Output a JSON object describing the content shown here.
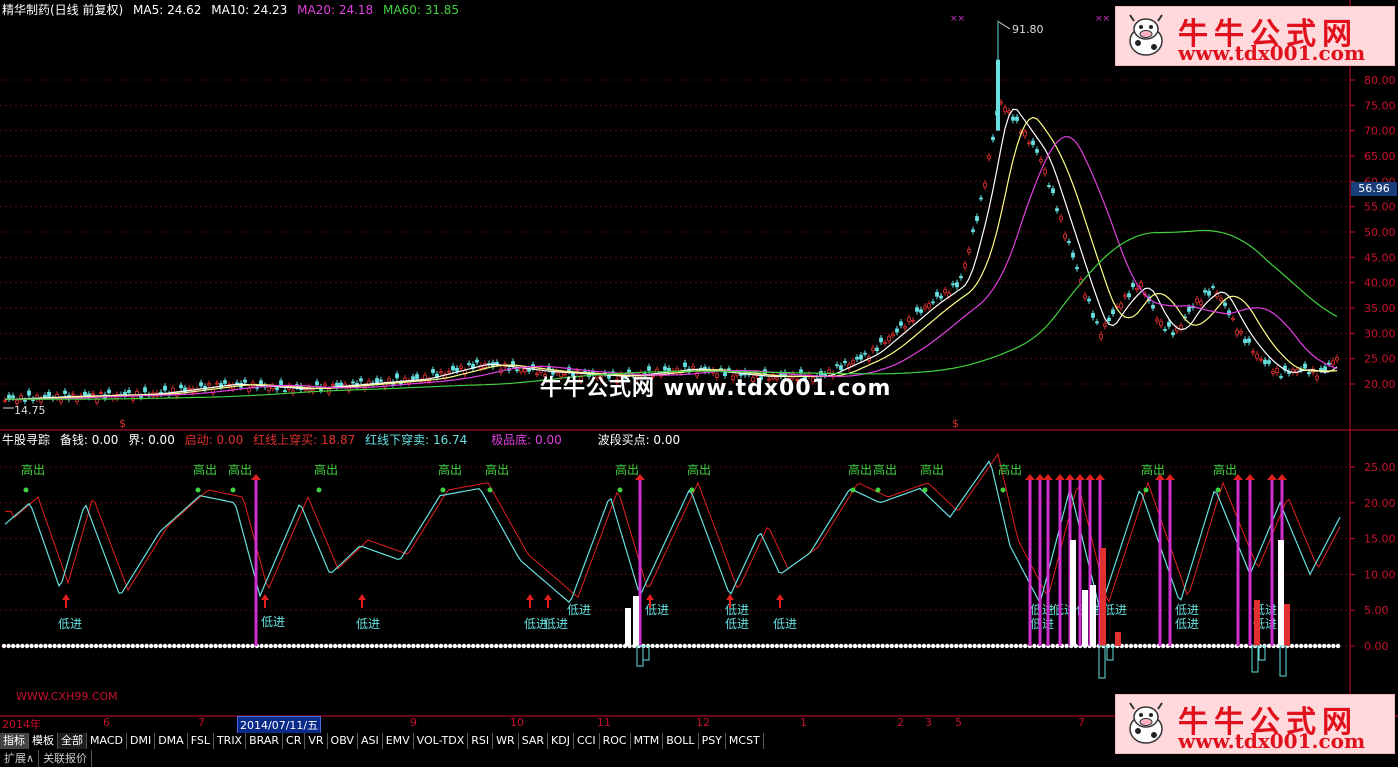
{
  "stock_header": {
    "title": "精华制药(日线 前复权)",
    "ma5": "MA5: 24.62",
    "ma10": "MA10: 24.23",
    "ma20": "MA20: 24.18",
    "ma60": "MA60: 31.85"
  },
  "colors": {
    "ma5": "#ffffff",
    "ma10": "#ffff66",
    "ma20": "#e040e0",
    "ma60": "#40d040",
    "axis": "#c8102e",
    "cyan": "#66e0e0"
  },
  "price_chart": {
    "high_label": "91.80",
    "low_label": "14.75",
    "current_price": "56.96",
    "y_ticks": [
      "80.00",
      "75.00",
      "70.00",
      "65.00",
      "60.00",
      "55.00",
      "50.00",
      "45.00",
      "40.00",
      "35.00",
      "30.00",
      "25.00",
      "20.00"
    ],
    "watermark": "牛牛公式网 www.tdx001.com"
  },
  "indicator_header": {
    "name": "牛股寻踪",
    "items": [
      "备钱: 0.00",
      "界: 0.00",
      "启动: 0.00",
      "红线上穿买: 18.87",
      "红线下穿卖: 16.74",
      "极品底: 0.00",
      "波段买点: 0.00"
    ]
  },
  "indicator_chart": {
    "y_ticks": [
      "25.00",
      "20.00",
      "15.00",
      "10.00",
      "5.00",
      "0.00"
    ],
    "signal_high": "高出",
    "signal_low": "低进",
    "site_text": "WWW.CXH99.COM"
  },
  "time_axis": {
    "labels": [
      "2014年",
      "6",
      "7",
      "2014/07/11/五",
      "9",
      "10",
      "11",
      "12",
      "1",
      "2",
      "3",
      "5",
      "7"
    ]
  },
  "tabs": [
    "指标",
    "模板",
    "全部",
    "MACD",
    "DMI",
    "DMA",
    "FSL",
    "TRIX",
    "BRAR",
    "CR",
    "VR",
    "OBV",
    "ASI",
    "EMV",
    "VOL-TDX",
    "RSI",
    "WR",
    "SAR",
    "KDJ",
    "CCI",
    "ROC",
    "MTM",
    "BOLL",
    "PSY",
    "MCST"
  ],
  "bottom_bar": [
    "扩展∧",
    "关联报价"
  ],
  "logo": {
    "title": "牛牛公式网",
    "url": "www.tdx001.com"
  }
}
